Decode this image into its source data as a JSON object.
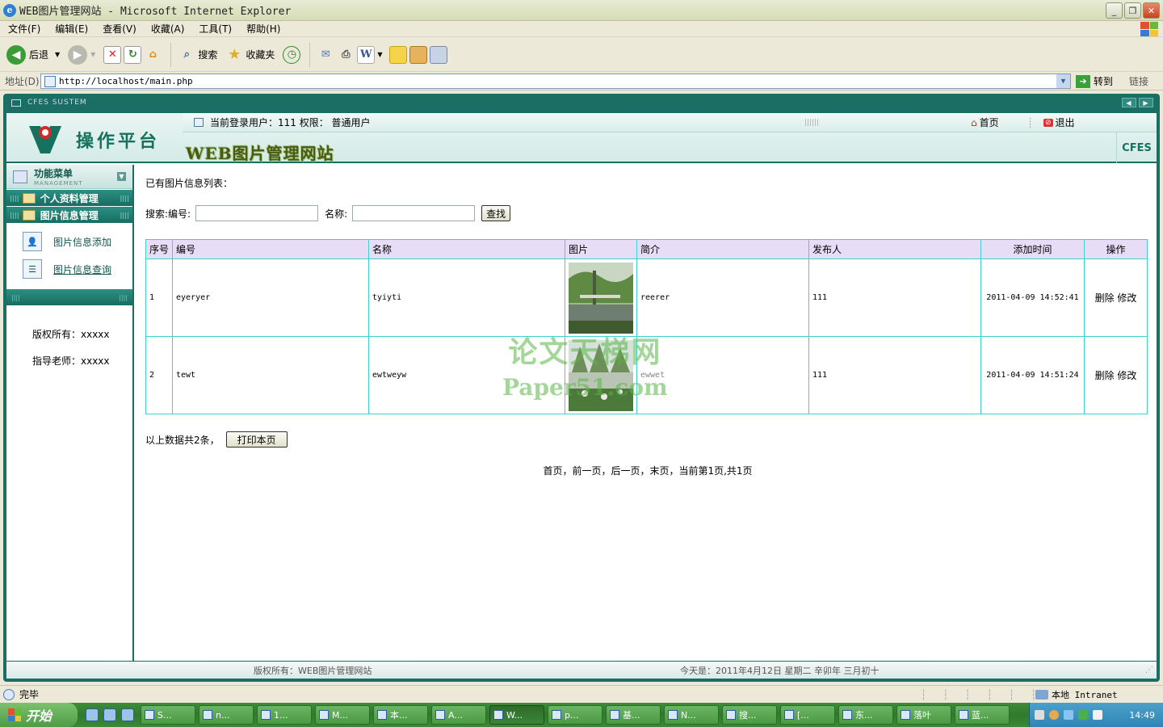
{
  "window": {
    "title": "WEB图片管理网站 - Microsoft Internet Explorer"
  },
  "menubar": [
    "文件(F)",
    "编辑(E)",
    "查看(V)",
    "收藏(A)",
    "工具(T)",
    "帮助(H)"
  ],
  "toolbar": {
    "back": "后退",
    "search": "搜索",
    "favorites": "收藏夹"
  },
  "address": {
    "label": "地址(D)",
    "url": "http://localhost/main.php",
    "goto": "转到",
    "links": "链接"
  },
  "app": {
    "system_label": "CFES SUSTEM",
    "platform_title": "操作平台",
    "site_title": "WEB图片管理网站",
    "cfes": "CFES",
    "user_info": "当前登录用户：111 权限： 普通用户",
    "home": "首页",
    "logout": "退出"
  },
  "sidebar": {
    "menu_title": "功能菜单",
    "menu_sub": "MANAGEMENT",
    "categories": [
      {
        "label": "个人资料管理"
      },
      {
        "label": "图片信息管理"
      }
    ],
    "items": [
      {
        "label": "图片信息添加"
      },
      {
        "label": "图片信息查询"
      }
    ],
    "copyright": "版权所有：xxxxx",
    "teacher": "指导老师：xxxxx"
  },
  "main": {
    "section_title": "已有图片信息列表：",
    "search_label": "搜索:编号:",
    "name_label": "名称:",
    "search_value": "",
    "name_value": "",
    "search_button": "查找",
    "columns": [
      "序号",
      "编号",
      "名称",
      "图片",
      "简介",
      "发布人",
      "添加时间",
      "操作"
    ],
    "rows": [
      {
        "idx": "1",
        "code": "eyeryer",
        "name": "tyiyti",
        "intro": "reerer",
        "publisher": "111",
        "time": "2011-04-09 14:52:41",
        "delete": "删除",
        "edit": "修改"
      },
      {
        "idx": "2",
        "code": "tewt",
        "name": "ewtweyw",
        "intro": "ewwet",
        "publisher": "111",
        "time": "2011-04-09 14:51:24",
        "delete": "删除",
        "edit": "修改"
      }
    ],
    "summary": "以上数据共2条，",
    "print_button": "打印本页",
    "pager": "首页，前一页，后一页，末页，当前第1页,共1页"
  },
  "watermark": {
    "line1": "论文天梯网",
    "line2": "Paper51.com"
  },
  "footer": {
    "left": "版权所有：WEB图片管理网站",
    "right": "今天是：2011年4月12日 星期二 辛卯年 三月初十"
  },
  "status": {
    "text": "完毕",
    "zone": "本地 Intranet"
  },
  "taskbar": {
    "start": "开始",
    "tasks": [
      "S...",
      "n...",
      "1...",
      "M...",
      "本...",
      "A...",
      "W...",
      "p...",
      "基...",
      "N...",
      "搜...",
      "[...",
      "东...",
      "落叶",
      "蓝..."
    ],
    "clock": "14:49"
  },
  "colors": {
    "accent": "#15705f",
    "table_border": "#3fd0d0",
    "header_bg": "#e7ddf6"
  }
}
